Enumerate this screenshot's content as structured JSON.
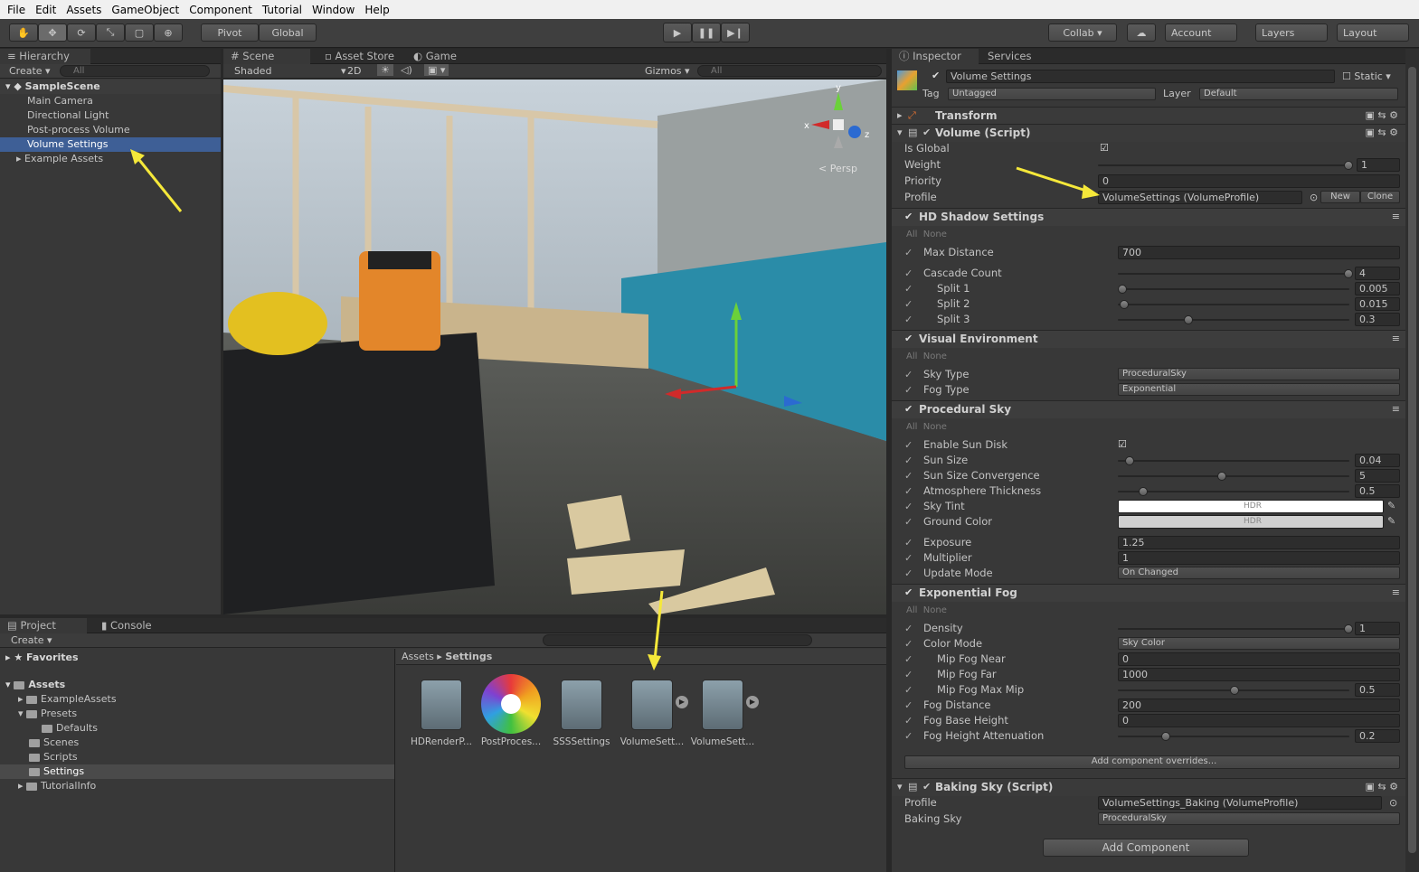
{
  "menu": [
    "File",
    "Edit",
    "Assets",
    "GameObject",
    "Component",
    "Tutorial",
    "Window",
    "Help"
  ],
  "toolbar": {
    "pivot": "Pivot",
    "global": "Global",
    "collab": "Collab ▾",
    "account": "Account",
    "layers": "Layers",
    "layout": "Layout"
  },
  "hierarchy": {
    "tab": "Hierarchy",
    "create": "Create ▾",
    "search": "All",
    "scene": "SampleScene",
    "items": [
      "Main Camera",
      "Directional Light",
      "Post-process Volume",
      "Volume Settings",
      "Example Assets"
    ]
  },
  "scene": {
    "tabs": [
      "Scene",
      "Asset Store",
      "Game"
    ],
    "shading": "Shaded",
    "mode2d": "2D",
    "gizmos": "Gizmos ▾",
    "search": "All",
    "persp": "Persp",
    "axis_x": "x",
    "axis_y": "y",
    "axis_z": "z"
  },
  "project": {
    "tabs": [
      "Project",
      "Console"
    ],
    "create": "Create ▾",
    "favorites": "Favorites",
    "assets": "Assets",
    "folders": [
      "ExampleAssets",
      "Presets",
      "Defaults",
      "Scenes",
      "Scripts",
      "Settings",
      "TutorialInfo"
    ],
    "breadcrumb": [
      "Assets",
      "Settings"
    ],
    "files": [
      "HDRenderP...",
      "PostProces...",
      "SSSSettings",
      "VolumeSett...",
      "VolumeSett..."
    ]
  },
  "inspector": {
    "tabs": [
      "Inspector",
      "Services"
    ],
    "object_name": "Volume Settings",
    "static": "Static",
    "tag_label": "Tag",
    "tag": "Untagged",
    "layer_label": "Layer",
    "layer": "Default",
    "transform": "Transform",
    "volume": {
      "title": "Volume (Script)",
      "is_global": "Is Global",
      "weight": "Weight",
      "weight_val": "1",
      "priority": "Priority",
      "priority_val": "0",
      "profile": "Profile",
      "profile_val": "VolumeSettings (VolumeProfile)",
      "new": "New",
      "clone": "Clone"
    },
    "all": "All",
    "none": "None",
    "hd_shadow": {
      "title": "HD Shadow Settings",
      "max_distance": "Max Distance",
      "max_distance_val": "700",
      "cascade_count": "Cascade Count",
      "cascade_count_val": "4",
      "split1": "Split 1",
      "split1_val": "0.005",
      "split2": "Split 2",
      "split2_val": "0.015",
      "split3": "Split 3",
      "split3_val": "0.3"
    },
    "visual_env": {
      "title": "Visual Environment",
      "sky_type": "Sky Type",
      "sky_type_val": "ProceduralSky",
      "fog_type": "Fog Type",
      "fog_type_val": "Exponential"
    },
    "procedural_sky": {
      "title": "Procedural Sky",
      "enable_sun_disk": "Enable Sun Disk",
      "sun_size": "Sun Size",
      "sun_size_val": "0.04",
      "sun_size_conv": "Sun Size Convergence",
      "sun_size_conv_val": "5",
      "atmo": "Atmosphere Thickness",
      "atmo_val": "0.5",
      "sky_tint": "Sky Tint",
      "ground_color": "Ground Color",
      "hdr": "HDR",
      "exposure": "Exposure",
      "exposure_val": "1.25",
      "multiplier": "Multiplier",
      "multiplier_val": "1",
      "update_mode": "Update Mode",
      "update_mode_val": "On Changed"
    },
    "exp_fog": {
      "title": "Exponential Fog",
      "density": "Density",
      "density_val": "1",
      "color_mode": "Color Mode",
      "color_mode_val": "Sky Color",
      "mip_near": "Mip Fog Near",
      "mip_near_val": "0",
      "mip_far": "Mip Fog Far",
      "mip_far_val": "1000",
      "mip_max": "Mip Fog Max Mip",
      "mip_max_val": "0.5",
      "fog_distance": "Fog Distance",
      "fog_distance_val": "200",
      "fog_base": "Fog Base Height",
      "fog_base_val": "0",
      "fog_height_att": "Fog Height Attenuation",
      "fog_height_att_val": "0.2"
    },
    "add_overrides": "Add component overrides...",
    "baking": {
      "title": "Baking Sky (Script)",
      "profile": "Profile",
      "profile_val": "VolumeSettings_Baking (VolumeProfile)",
      "baking_sky": "Baking Sky",
      "baking_sky_val": "ProceduralSky"
    },
    "add_component": "Add Component"
  },
  "colors": {
    "selection": "#3e5f96",
    "arrow": "#f5e83a",
    "panel": "#383838"
  }
}
